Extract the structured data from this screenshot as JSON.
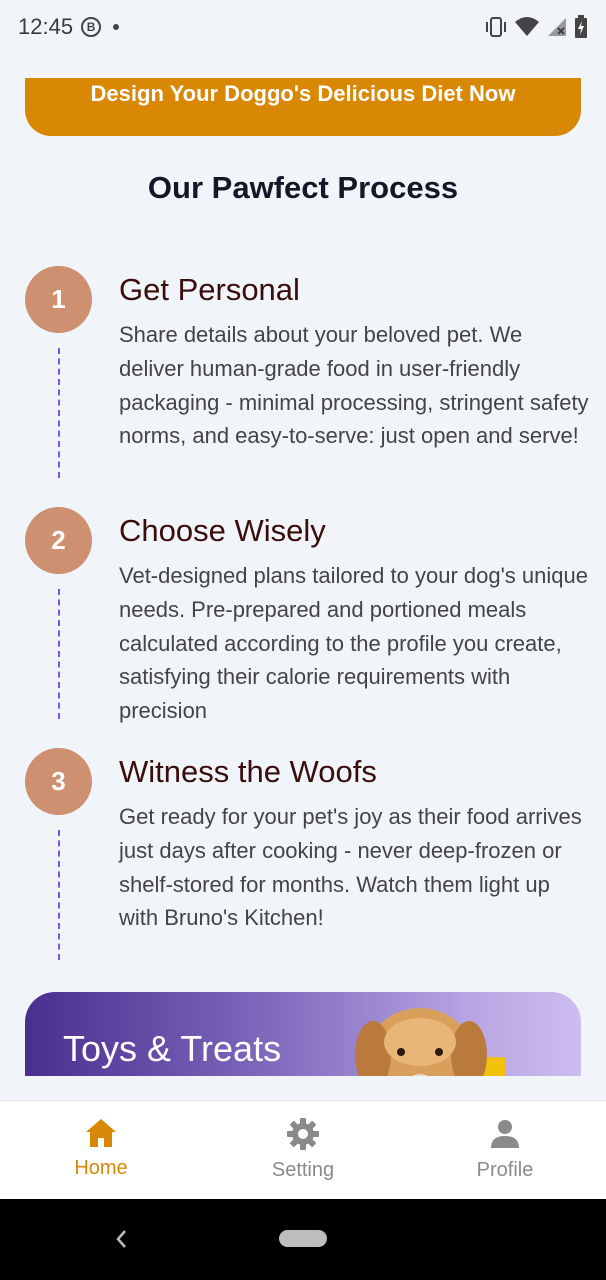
{
  "status_bar": {
    "time": "12:45",
    "b_badge": "B"
  },
  "cta": {
    "label": "Design Your Doggo's Delicious Diet Now"
  },
  "process": {
    "title": "Our Pawfect Process",
    "steps": [
      {
        "number": "1",
        "title": "Get Personal",
        "description": "Share details about your beloved pet. We deliver human-grade food in user-friendly packaging - minimal processing, stringent safety norms, and easy-to-serve: just open and serve!"
      },
      {
        "number": "2",
        "title": "Choose Wisely",
        "description": "Vet-designed plans tailored to your dog's unique needs. Pre-prepared and portioned meals calculated according to the profile you create, satisfying their calorie requirements with precision"
      },
      {
        "number": "3",
        "title": "Witness the Woofs",
        "description": "Get ready for your pet's joy as their food arrives just days after cooking - never deep-frozen or shelf-stored for months. Watch them light up with Bruno's Kitchen!"
      }
    ]
  },
  "toys_banner": {
    "title": "Toys & Treats"
  },
  "bottom_nav": {
    "items": [
      {
        "label": "Home",
        "icon": "home-icon",
        "active": true
      },
      {
        "label": "Setting",
        "icon": "gear-icon",
        "active": false
      },
      {
        "label": "Profile",
        "icon": "person-icon",
        "active": false
      }
    ]
  },
  "colors": {
    "accent": "#d98806",
    "step_circle": "#cd9070",
    "step_title": "#3a0d0d",
    "dashed_line": "#7a55e6",
    "background": "#f1f5f9"
  }
}
